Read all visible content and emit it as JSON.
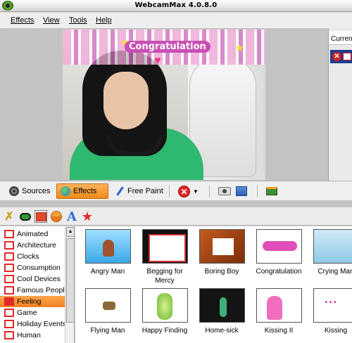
{
  "window": {
    "title": "WebcamMax  4.0.8.0"
  },
  "menu": [
    "Effects",
    "View",
    "Tools",
    "Help"
  ],
  "preview": {
    "overlay_text": "Congratulation"
  },
  "right_panel": {
    "header": "Current"
  },
  "toolbar": {
    "sources": "Sources",
    "effects": "Effects",
    "free_paint": "Free Paint"
  },
  "categories": [
    "Animated",
    "Architecture",
    "Clocks",
    "Consumption",
    "Cool Devices",
    "Famous People",
    "Feeling",
    "Game",
    "Holiday Events",
    "Human"
  ],
  "selected_category": "Feeling",
  "effects": [
    {
      "label": "Angry Man"
    },
    {
      "label": "Begging for",
      "label2": "Mercy"
    },
    {
      "label": "Boring Boy"
    },
    {
      "label": "Congratulation"
    },
    {
      "label": "Crying Man"
    },
    {
      "label": "Flying Man"
    },
    {
      "label": "Happy Finding"
    },
    {
      "label": "Home-sick"
    },
    {
      "label": "Kissing II"
    },
    {
      "label": "Kissing"
    }
  ],
  "colors": {
    "accent_orange": "#f08a18",
    "folder_red": "#e02a2a",
    "selection_blue": "#1f3c8f"
  }
}
